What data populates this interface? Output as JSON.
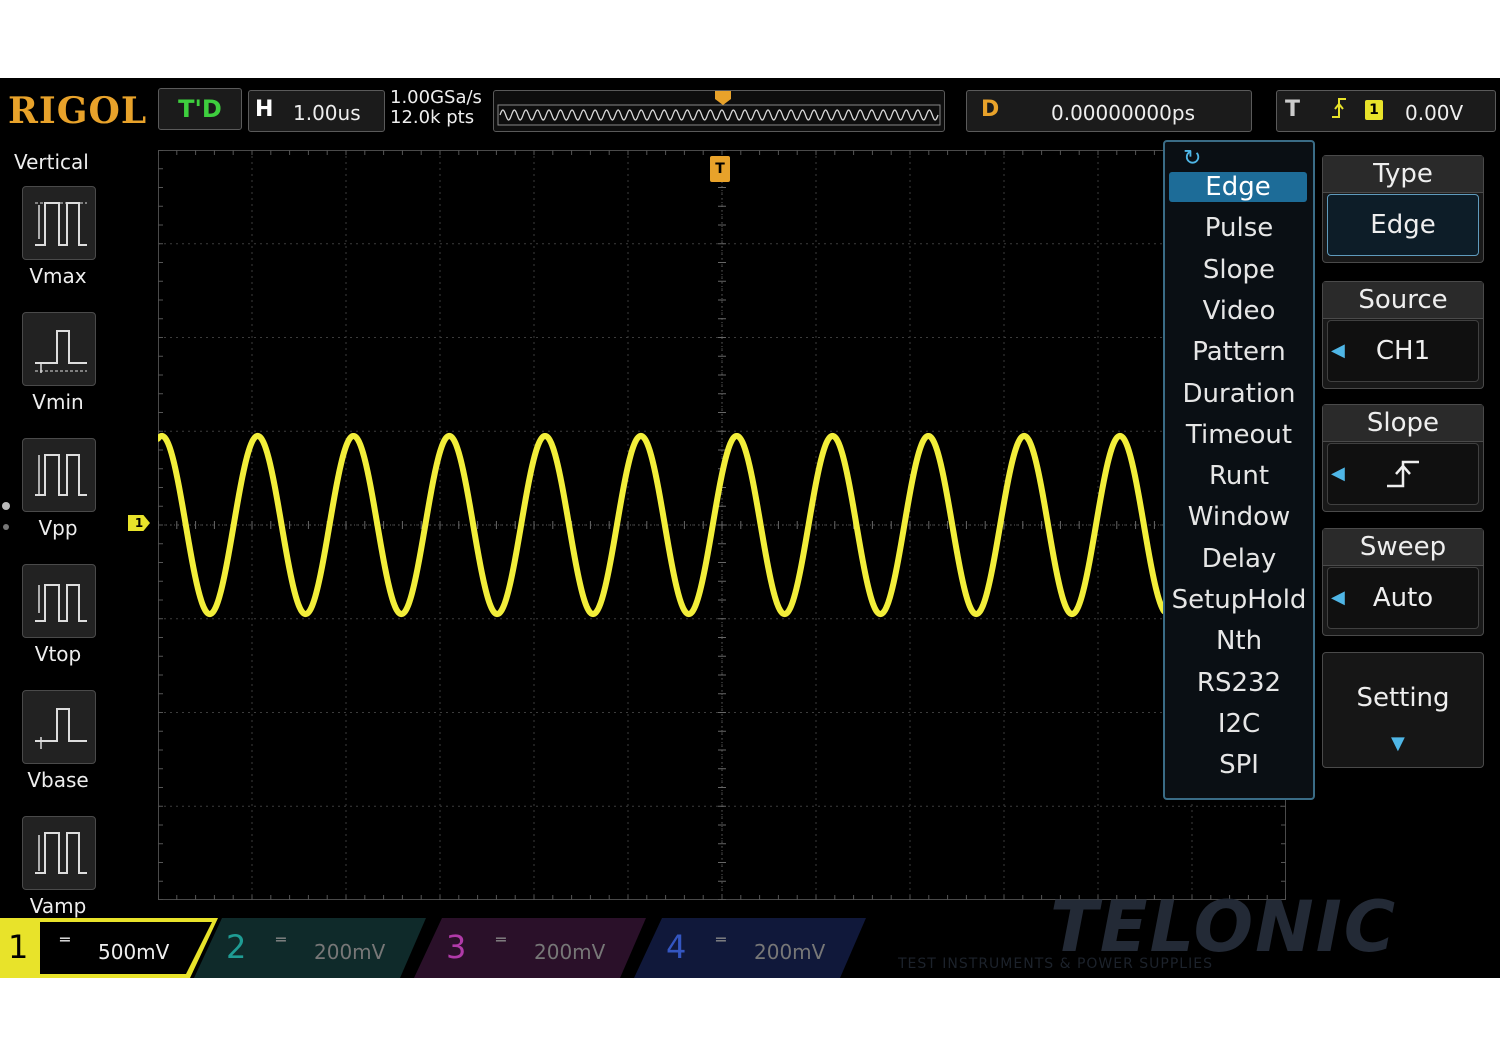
{
  "brand": "RIGOL",
  "status": "T'D",
  "timebase": {
    "label": "H",
    "value": "1.00us"
  },
  "sample": {
    "rate": "1.00GSa/s",
    "depth": "12.0k pts"
  },
  "delay": {
    "label": "D",
    "value": "0.00000000ps"
  },
  "trigger": {
    "label": "T",
    "channel": "1",
    "level": "0.00V",
    "marker": "T"
  },
  "vertical_panel": {
    "title": "Vertical",
    "items": [
      "Vmax",
      "Vmin",
      "Vpp",
      "Vtop",
      "Vbase",
      "Vamp"
    ]
  },
  "ch1_marker": "1",
  "trigger_type_menu": {
    "items": [
      "Edge",
      "Pulse",
      "Slope",
      "Video",
      "Pattern",
      "Duration",
      "Timeout",
      "Runt",
      "Window",
      "Delay",
      "SetupHold",
      "Nth",
      "RS232",
      "I2C",
      "SPI"
    ],
    "selected": "Edge"
  },
  "softkeys": {
    "type": {
      "title": "Type",
      "value": "Edge"
    },
    "source": {
      "title": "Source",
      "value": "CH1"
    },
    "slope": {
      "title": "Slope"
    },
    "sweep": {
      "title": "Sweep",
      "value": "Auto"
    },
    "setting": {
      "title": "Setting"
    }
  },
  "channels": [
    {
      "num": "1",
      "scale": "500mV",
      "color": "#e8e32a",
      "active": true
    },
    {
      "num": "2",
      "scale": "200mV",
      "color": "#1f9c94",
      "active": false
    },
    {
      "num": "3",
      "scale": "200mV",
      "color": "#b03aa8",
      "active": false
    },
    {
      "num": "4",
      "scale": "200mV",
      "color": "#3456c0",
      "active": false
    }
  ],
  "watermark": {
    "name": "TELONIC",
    "tagline": "TEST INSTRUMENTS & POWER SUPPLIES"
  },
  "waveform": {
    "cycles": 10.5,
    "amplitude_div": 0.95,
    "color": "#f2ee3a"
  },
  "colors": {
    "accent_orange": "#e8a22a",
    "menu_highlight": "#1d6c98",
    "status_green": "#3ecf3e"
  }
}
